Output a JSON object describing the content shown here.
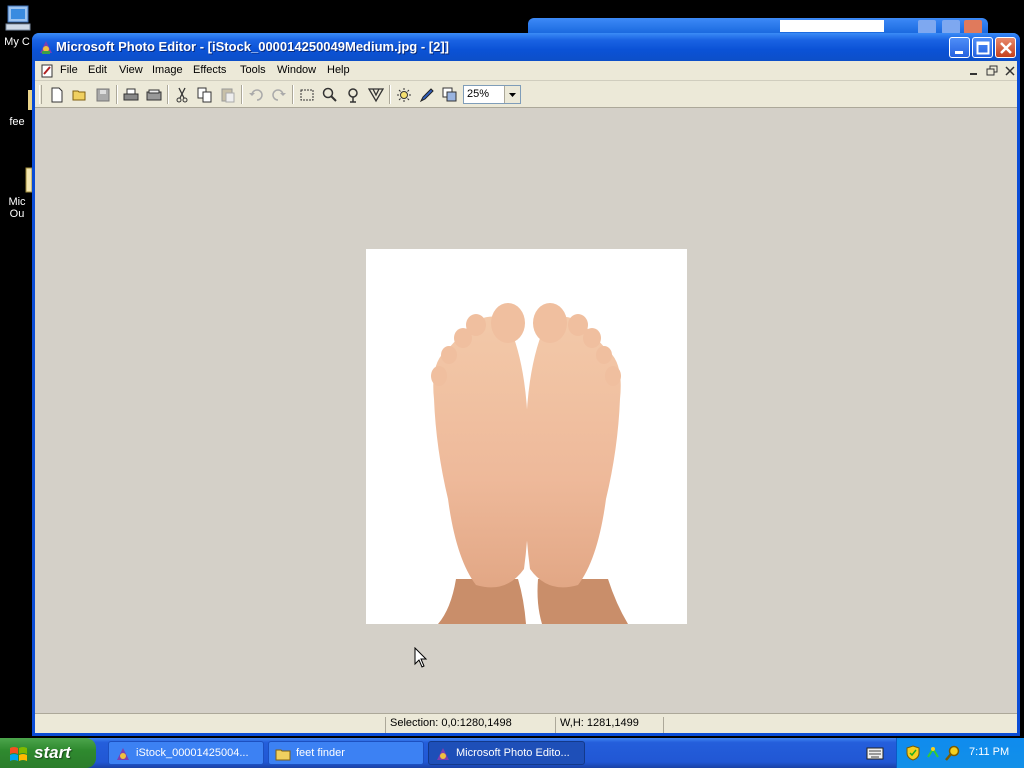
{
  "desktop": {
    "icons": [
      {
        "label": "My C",
        "icon": "my-computer-icon"
      },
      {
        "label": "fee",
        "icon": "folder-icon"
      },
      {
        "label": "Mic",
        "label2": "Ou",
        "icon": "outlook-icon"
      }
    ]
  },
  "window": {
    "title": "Microsoft Photo Editor - [iStock_000014250049Medium.jpg - [2]]",
    "menu": [
      "File",
      "Edit",
      "View",
      "Image",
      "Effects",
      "Tools",
      "Window",
      "Help"
    ],
    "zoom": "25%",
    "toolbar_icons": [
      "new-file-icon",
      "open-folder-icon",
      "save-icon",
      "print-icon",
      "scan-icon",
      "cut-icon",
      "copy-icon",
      "paste-icon",
      "undo-icon",
      "redo-icon",
      "select-icon",
      "zoom-icon",
      "smudge-icon",
      "balance-icon",
      "sharpen-icon",
      "pen-icon",
      "clone-icon"
    ]
  },
  "status": {
    "selection": "Selection: 0,0:1280,1498",
    "size": "W,H: 1281,1499"
  },
  "taskbar": {
    "start_label": "start",
    "buttons": [
      {
        "label": "iStock_00001425004...",
        "icon": "photo-editor-icon"
      },
      {
        "label": "feet finder",
        "icon": "folder-icon"
      },
      {
        "label": "Microsoft Photo Edito...",
        "icon": "photo-editor-icon",
        "active": true
      }
    ],
    "clock": "7:11 PM"
  },
  "colors": {
    "title_blue": "#0b52d6",
    "workspace": "#d4d0c8",
    "start_green": "#2f8a2f"
  }
}
